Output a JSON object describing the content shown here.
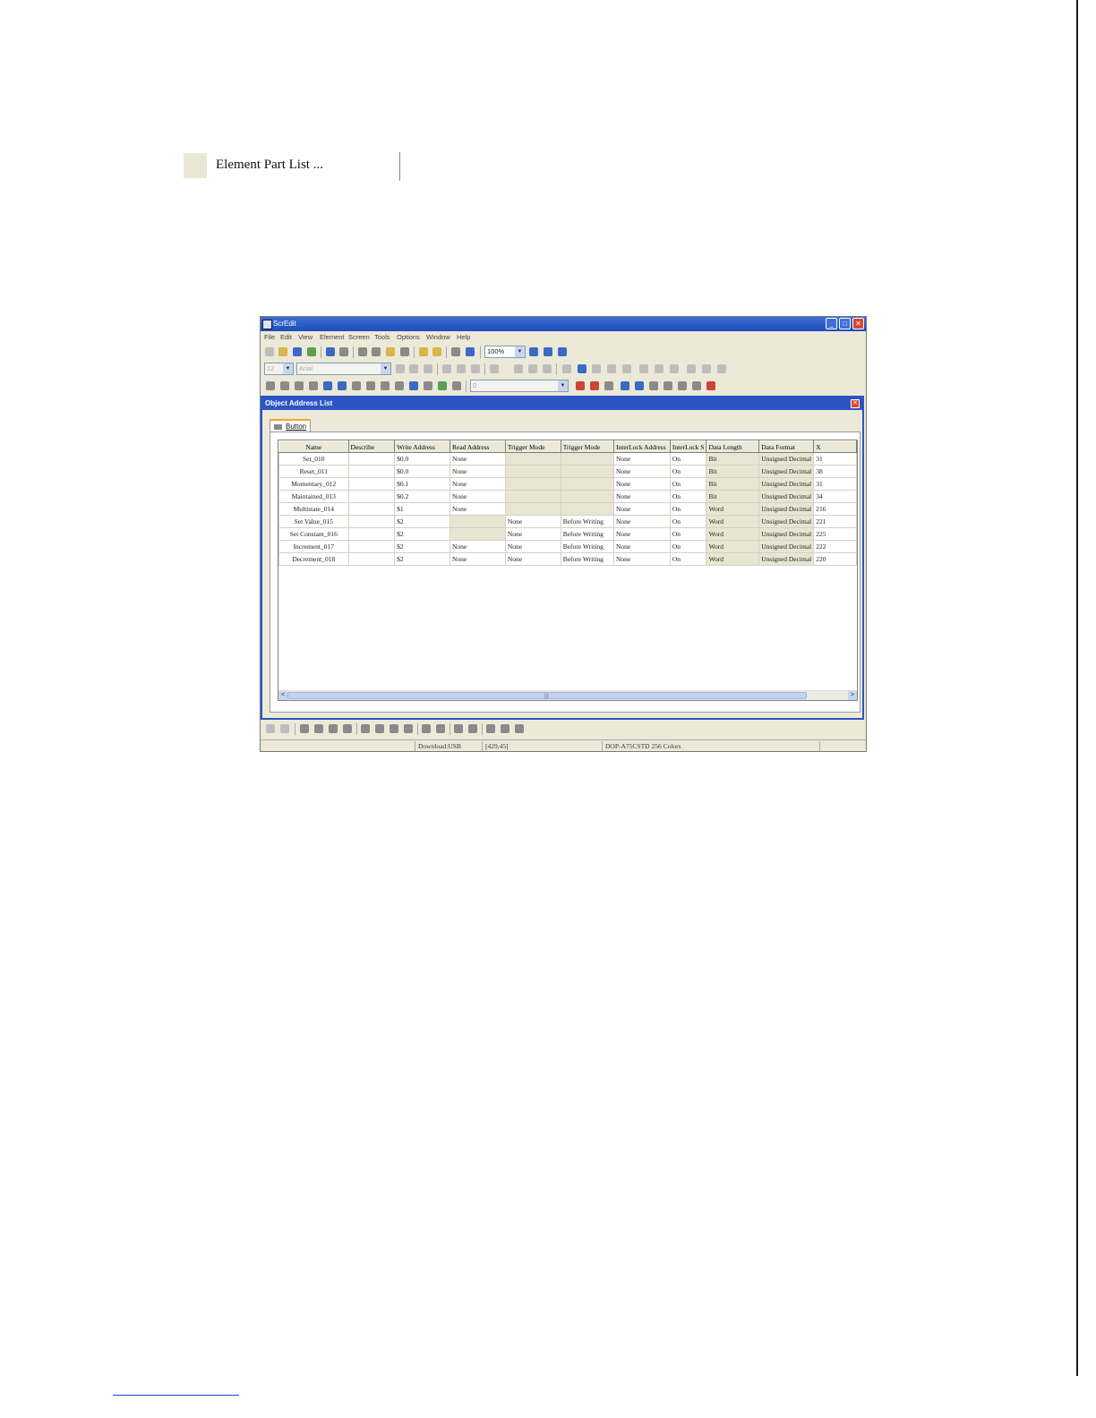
{
  "page": {
    "heading": "Element Part List ..."
  },
  "app": {
    "title": "ScrEdit",
    "window_buttons": {
      "minimize": "_",
      "maximize": "□",
      "close": "✕"
    },
    "menu": [
      "File",
      "Edit",
      "View",
      "Element",
      "Screen",
      "Tools",
      "Options",
      "Window",
      "Help"
    ],
    "toolbar": {
      "zoom": "100%",
      "font_size": "12",
      "font_name": "Arial",
      "layer": "0"
    }
  },
  "object_address_list": {
    "title": "Object Address List",
    "close": "✕",
    "tab": "Button",
    "columns": [
      "Name",
      "Describe",
      "Write Address",
      "Read Address",
      "Trigger Mode",
      "Trigger Mode",
      "InterLock Address",
      "InterLock S",
      "Data Length",
      "Data Format",
      "X"
    ],
    "rows": [
      [
        "Set_010",
        "",
        "$0.0",
        "None",
        "",
        "",
        "None",
        "On",
        "Bit",
        "Unsigned Decimal",
        "31"
      ],
      [
        "Reset_011",
        "",
        "$0.0",
        "None",
        "",
        "",
        "None",
        "On",
        "Bit",
        "Unsigned Decimal",
        "38"
      ],
      [
        "Momentary_012",
        "",
        "$0.1",
        "None",
        "",
        "",
        "None",
        "On",
        "Bit",
        "Unsigned Decimal",
        "31"
      ],
      [
        "Maintained_013",
        "",
        "$0.2",
        "None",
        "",
        "",
        "None",
        "On",
        "Bit",
        "Unsigned Decimal",
        "34"
      ],
      [
        "Multistate_014",
        "",
        "$1",
        "None",
        "",
        "",
        "None",
        "On",
        "Word",
        "Unsigned Decimal",
        "216"
      ],
      [
        "Set Value_015",
        "",
        "$2",
        "",
        "None",
        "Before Writing",
        "None",
        "On",
        "Word",
        "Unsigned Decimal",
        "221"
      ],
      [
        "Set Constant_016",
        "",
        "$2",
        "",
        "None",
        "Before Writing",
        "None",
        "On",
        "Word",
        "Unsigned Decimal",
        "225"
      ],
      [
        "Increment_017",
        "",
        "$2",
        "None",
        "None",
        "Before Writing",
        "None",
        "On",
        "Word",
        "Unsigned Decimal",
        "222"
      ],
      [
        "Decrement_018",
        "",
        "$2",
        "None",
        "None",
        "Before Writing",
        "None",
        "On",
        "Word",
        "Unsigned Decimal",
        "220"
      ]
    ],
    "scroll_left": "<",
    "scroll_right": ">",
    "scroll_grip": "|||"
  },
  "statusbar": {
    "download": "Download:USB",
    "coords": "[429,45]",
    "model": "DOP-A75CSTD 256 Colors"
  }
}
